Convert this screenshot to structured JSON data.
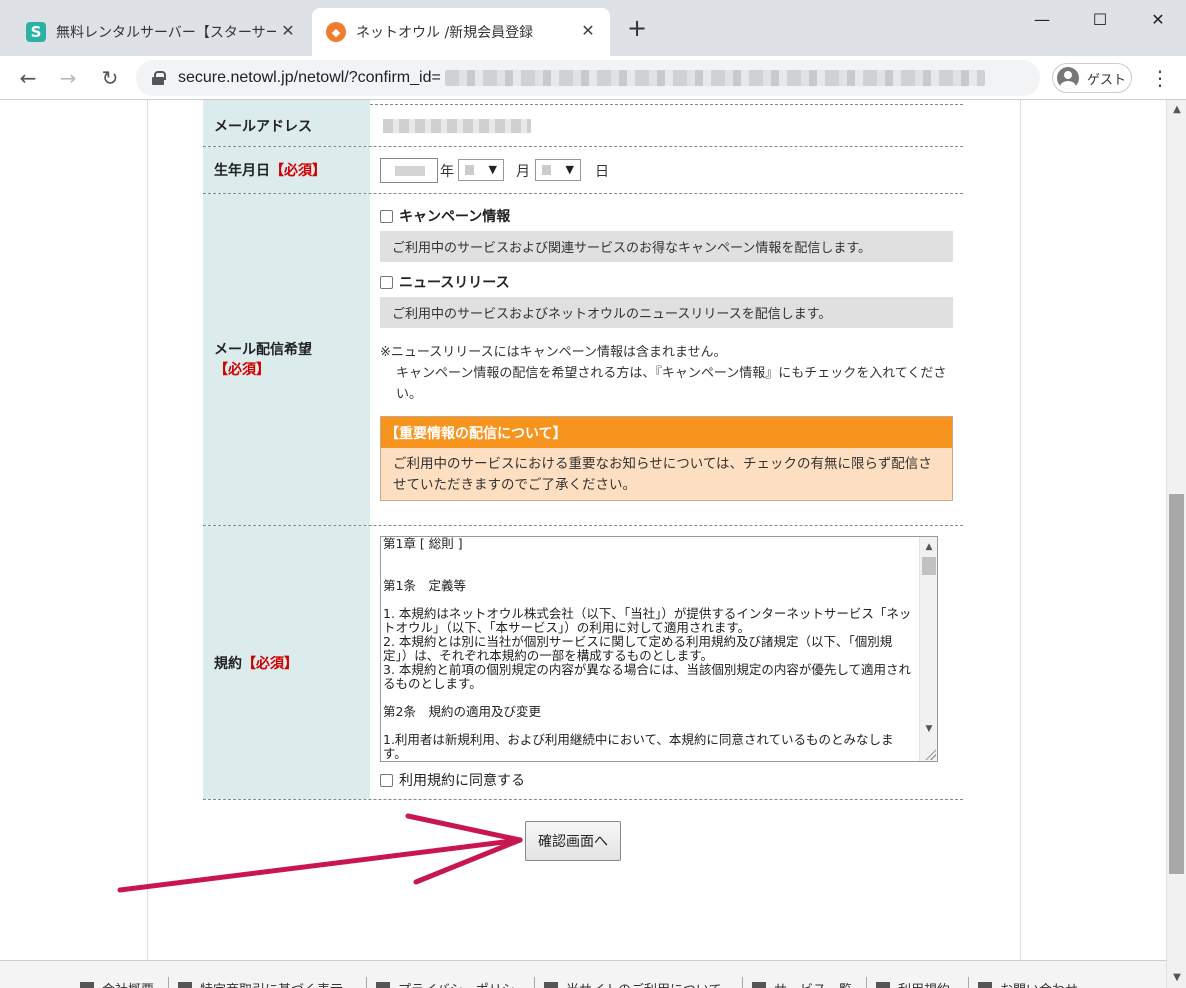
{
  "browser": {
    "tabs": [
      {
        "title": "無料レンタルサーバー【スターサーバーフリー】",
        "favicon": "starserver-icon"
      },
      {
        "title": "ネットオウル /新規会員登録",
        "favicon": "netowl-icon"
      }
    ],
    "url_host": "secure.netowl.jp/netowl/?confirm_id=",
    "profile_label": "ゲスト"
  },
  "form": {
    "email": {
      "label": "メールアドレス"
    },
    "dob": {
      "label": "生年月日",
      "required": "【必須】",
      "year_unit": "年",
      "month_unit": "月",
      "day_unit": "日"
    },
    "newsletter": {
      "label": "メール配信希望",
      "required": "【必須】",
      "campaign": {
        "label": "キャンペーン情報",
        "desc": "ご利用中のサービスおよび関連サービスのお得なキャンペーン情報を配信します。"
      },
      "news": {
        "label": "ニュースリリース",
        "desc": "ご利用中のサービスおよびネットオウルのニュースリリースを配信します。"
      },
      "note1": "※ニュースリリースにはキャンペーン情報は含まれません。",
      "note2": "キャンペーン情報の配信を希望される方は、『キャンペーン情報』にもチェックを入れてください。",
      "important_title": "【重要情報の配信について】",
      "important_body": "ご利用中のサービスにおける重要なお知らせについては、チェックの有無に限らず配信させていただきますのでご了承ください。"
    },
    "terms": {
      "label": "規約",
      "required": "【必須】",
      "text": "第1章 [ 総則 ]\n\n\n第1条　定義等\n\n1. 本規約はネットオウル株式会社（以下、「当社」）が提供するインターネットサービス「ネットオウル」（以下、「本サービス」）の利用に対して適用されます。\n2. 本規約とは別に当社が個別サービスに関して定める利用規約及び諸規定（以下、「個別規定」）は、それぞれ本規約の一部を構成するものとします。\n3. 本規約と前項の個別規定の内容が異なる場合には、当該個別規定の内容が優先して適用されるものとします。\n\n第2条　規約の適用及び変更\n\n1.利用者は新規利用、および利用継続中において、本規約に同意されているものとみなします。",
      "agree_label": "利用規約に同意する"
    },
    "submit_label": "確認画面へ"
  },
  "footer": {
    "links": [
      "会社概要",
      "特定商取引に基づく表示",
      "プライバシーポリシー",
      "当サイトのご利用について",
      "サービス一覧",
      "利用規約",
      "お問い合わせ"
    ]
  },
  "colors": {
    "header_cell_bg": "#dcecec",
    "required_red": "#d10000",
    "important_orange": "#f7941d",
    "important_bg": "#ffdfc1",
    "annotation_arrow": "#c8164f"
  }
}
